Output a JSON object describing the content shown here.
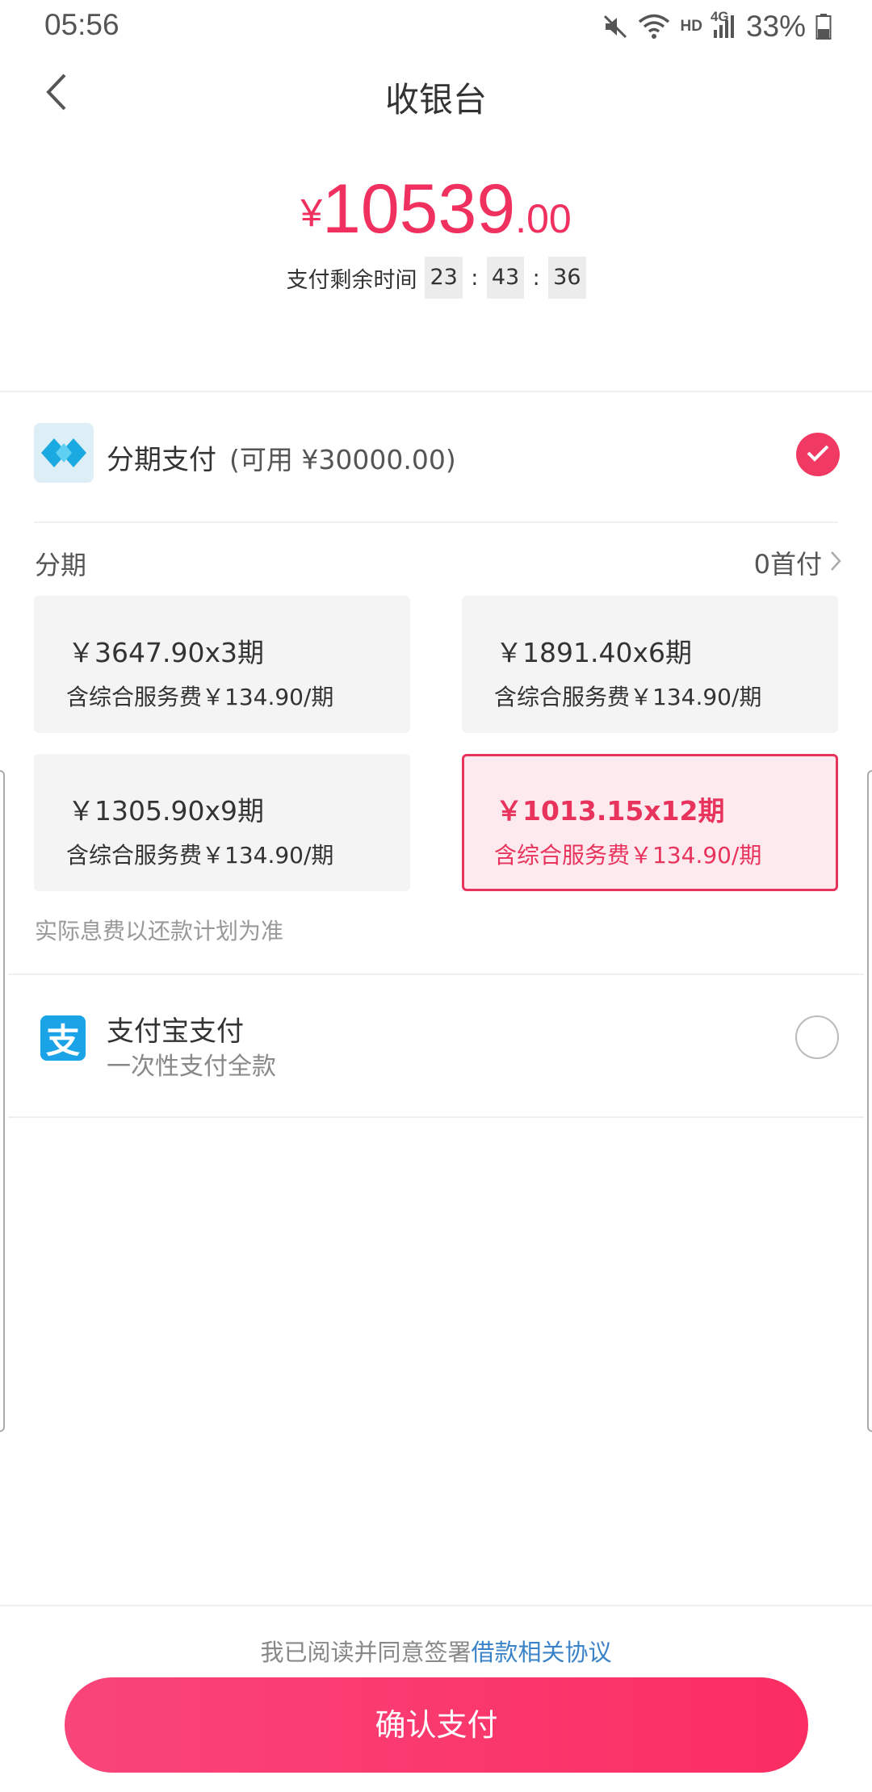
{
  "status_bar": {
    "time": "05:56",
    "battery": "33%",
    "network_label": "HD",
    "network_gen": "4G",
    "icons": [
      "mute-icon",
      "wifi-icon",
      "signal-icon",
      "battery-icon"
    ]
  },
  "nav": {
    "title": "收银台",
    "back_icon": "chevron-left-icon"
  },
  "amount": {
    "currency": "¥",
    "integer": "10539",
    "decimal": ".00"
  },
  "timer": {
    "label": "支付剩余时间",
    "hours": "23",
    "minutes": "43",
    "seconds": "36",
    "separator": ":"
  },
  "installment_method": {
    "title": "分期支付",
    "available": "(可用 ¥30000.00)",
    "selected": true
  },
  "installment": {
    "section_label": "分期",
    "down_payment": "0首付",
    "plans": [
      {
        "main": "￥3647.90x3期",
        "fee": "含综合服务费￥134.90/期",
        "selected": false
      },
      {
        "main": "￥1891.40x6期",
        "fee": "含综合服务费￥134.90/期",
        "selected": false
      },
      {
        "main": "￥1305.90x9期",
        "fee": "含综合服务费￥134.90/期",
        "selected": false
      },
      {
        "main": "￥1013.15x12期",
        "fee": "含综合服务费￥134.90/期",
        "selected": true
      }
    ],
    "note": "实际息费以还款计划为准"
  },
  "alipay": {
    "icon_char": "支",
    "title": "支付宝支付",
    "subtitle": "一次性支付全款",
    "selected": false
  },
  "footer": {
    "agreement_text": "我已阅读并同意签署",
    "agreement_link": "借款相关协议",
    "confirm_label": "确认支付"
  },
  "colors": {
    "accent": "#f0305f",
    "link": "#3a83c8",
    "alipay_blue": "#1ba3e8"
  }
}
